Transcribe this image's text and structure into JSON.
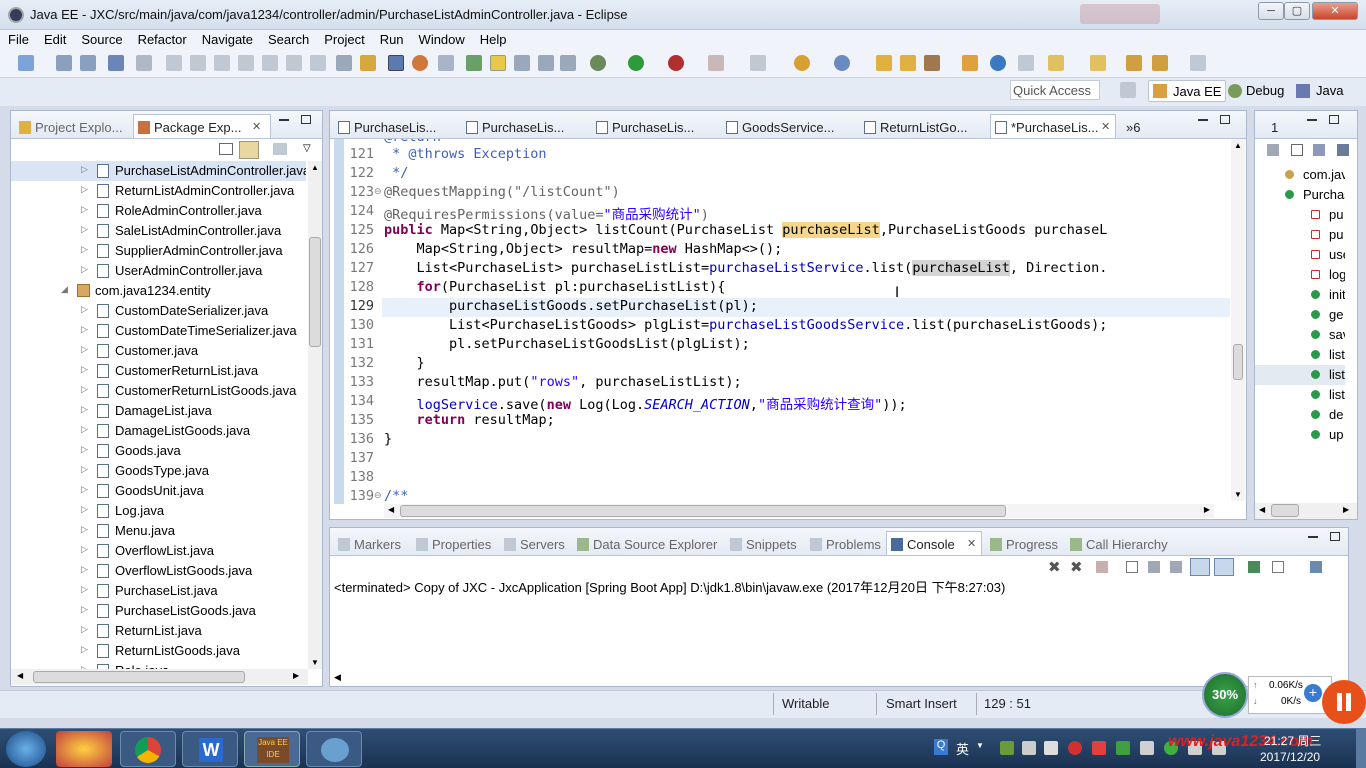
{
  "window": {
    "title": "Java EE - JXC/src/main/java/com/java1234/controller/admin/PurchaseListAdminController.java - Eclipse",
    "minimize": "─",
    "maximize": "▢",
    "close": "✕"
  },
  "menu": [
    "File",
    "Edit",
    "Source",
    "Refactor",
    "Navigate",
    "Search",
    "Project",
    "Run",
    "Window",
    "Help"
  ],
  "quick_access": "Quick Access",
  "perspectives": [
    "Java EE",
    "Debug",
    "Java"
  ],
  "left_panel": {
    "tabs": [
      "Project Explo...",
      "Package Exp..."
    ],
    "items": [
      {
        "label": "PurchaseListAdminController.java",
        "selected": true
      },
      {
        "label": "ReturnListAdminController.java"
      },
      {
        "label": "RoleAdminController.java"
      },
      {
        "label": "SaleListAdminController.java"
      },
      {
        "label": "SupplierAdminController.java"
      },
      {
        "label": "UserAdminController.java"
      },
      {
        "label": "com.java1234.entity",
        "package": true
      },
      {
        "label": "CustomDateSerializer.java"
      },
      {
        "label": "CustomDateTimeSerializer.java"
      },
      {
        "label": "Customer.java"
      },
      {
        "label": "CustomerReturnList.java"
      },
      {
        "label": "CustomerReturnListGoods.java"
      },
      {
        "label": "DamageList.java"
      },
      {
        "label": "DamageListGoods.java"
      },
      {
        "label": "Goods.java"
      },
      {
        "label": "GoodsType.java"
      },
      {
        "label": "GoodsUnit.java"
      },
      {
        "label": "Log.java"
      },
      {
        "label": "Menu.java"
      },
      {
        "label": "OverflowList.java"
      },
      {
        "label": "OverflowListGoods.java"
      },
      {
        "label": "PurchaseList.java"
      },
      {
        "label": "PurchaseListGoods.java"
      },
      {
        "label": "ReturnList.java"
      },
      {
        "label": "ReturnListGoods.java"
      },
      {
        "label": "Role.java"
      }
    ]
  },
  "editor": {
    "tabs": [
      "PurchaseLis...",
      "PurchaseLis...",
      "PurchaseLis...",
      "GoodsService...",
      "ReturnListGo...",
      "*PurchaseLis..."
    ],
    "overflow": "»6",
    "line_numbers": [
      "121",
      "122",
      "123",
      "124",
      "125",
      "126",
      "127",
      "128",
      "129",
      "130",
      "131",
      "132",
      "133",
      "134",
      "135",
      "136",
      "137",
      "138",
      "139"
    ],
    "lines": {
      "l121": " * @throws Exception",
      "l122": " */",
      "l123": "@RequestMapping(\"/listCount\")",
      "l124a": "@RequiresPermissions(value=",
      "l124b": "\"商品采购统计\"",
      "l124c": ")",
      "l125a": "public",
      "l125b": " Map<String,Object> listCount(PurchaseList ",
      "l125c": "purchaseList",
      "l125d": ",PurchaseListGoods purchaseL",
      "l126a": "    Map<String,Object> resultMap=",
      "l126b": "new",
      "l126c": " HashMap<>();",
      "l127a": "    List<PurchaseList> purchaseListList=",
      "l127b": "purchaseListService",
      "l127c": ".list(",
      "l127d": "purchaseList",
      "l127e": ", Direction.",
      "l128a": "    ",
      "l128b": "for",
      "l128c": "(PurchaseList pl:purchaseListList){",
      "l129": "        purchaseListGoods.setPurchaseList(pl);",
      "l130a": "        List<PurchaseListGoods> plgList=",
      "l130b": "purchaseListGoodsService",
      "l130c": ".list(purchaseListGoods);",
      "l131": "        pl.setPurchaseListGoodsList(plgList);",
      "l132": "    }",
      "l133a": "    resultMap.put(",
      "l133b": "\"rows\"",
      "l133c": ", purchaseListList);",
      "l134a": "    ",
      "l134b": "logService",
      "l134c": ".save(",
      "l134d": "new",
      "l134e": " Log(Log.",
      "l134f": "SEARCH_ACTION",
      "l134g": ",",
      "l134h": "\"商品采购统计查询\"",
      "l134i": "));",
      "l135a": "    ",
      "l135b": "return",
      "l135c": " resultMap;",
      "l136": "}",
      "l139": "/**"
    }
  },
  "right_panel": {
    "tab": "1",
    "items": [
      "com.jav",
      "Purchas",
      "pu",
      "pu",
      "use",
      "log",
      "init",
      "ge",
      "sav",
      "list",
      "list",
      "list",
      "de",
      "up"
    ]
  },
  "console": {
    "tabs": [
      "Markers",
      "Properties",
      "Servers",
      "Data Source Explorer",
      "Snippets",
      "Problems",
      "Console",
      "Progress",
      "Call Hierarchy"
    ],
    "status": "<terminated> Copy of JXC - JxcApplication [Spring Boot App] D:\\jdk1.8\\bin\\javaw.exe (2017年12月20日 下午8:27:03)"
  },
  "status_bar": {
    "mode": "Writable",
    "insert": "Smart Insert",
    "position": "129 : 51"
  },
  "widget": {
    "percent": "30%",
    "up": "0.06K/s",
    "down": "0K/s"
  },
  "taskbar": {
    "ime": "英",
    "time": "21:27 周三",
    "date": "2017/12/20",
    "watermark": "www.java1234.com",
    "eclipse_label": "Java EE IDE"
  },
  "colors": {
    "keyword": "#7f0055",
    "string": "#2a00ff",
    "comment": "#3f5fbf",
    "field": "#0000c0",
    "highlight": "#f5d68a"
  }
}
